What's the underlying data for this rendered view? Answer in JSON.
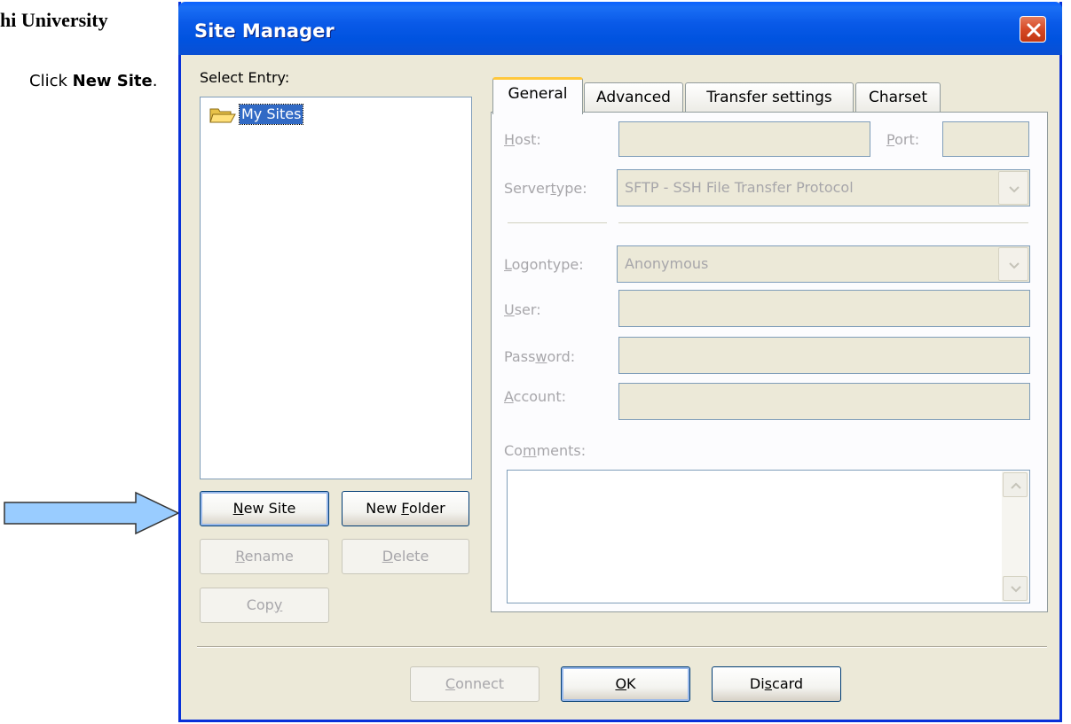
{
  "doc": {
    "title_fragment": "hi University",
    "instruction_prefix": "Click ",
    "instruction_bold": "New Site",
    "instruction_suffix": "."
  },
  "window": {
    "title": "Site Manager",
    "close_icon": "close-icon"
  },
  "left": {
    "select_entry_label": "Select Entry:",
    "tree": [
      {
        "label": "My Sites",
        "icon": "folder-open-icon",
        "selected": true
      }
    ],
    "buttons": {
      "new_site": {
        "mnemonic": "N",
        "rest": "ew Site"
      },
      "new_folder": {
        "pre": "New ",
        "mnemonic": "F",
        "rest": "older"
      },
      "rename": {
        "mnemonic": "R",
        "rest": "ename"
      },
      "delete": {
        "mnemonic": "D",
        "rest": "elete"
      },
      "copy": {
        "pre": "Cop",
        "mnemonic": "y",
        "rest": ""
      }
    }
  },
  "tabs": [
    {
      "label": "General",
      "active": true
    },
    {
      "label": "Advanced",
      "active": false
    },
    {
      "label": "Transfer settings",
      "active": false
    },
    {
      "label": "Charset",
      "active": false
    }
  ],
  "general": {
    "host": {
      "pre": "",
      "mnemonic": "H",
      "rest": "ost:",
      "value": ""
    },
    "port": {
      "pre": "",
      "mnemonic": "P",
      "rest": "ort:",
      "value": ""
    },
    "servertype": {
      "pre": "Server",
      "mnemonic": "t",
      "rest": "ype:",
      "value": "SFTP - SSH File Transfer Protocol"
    },
    "logontype": {
      "pre": "",
      "mnemonic": "L",
      "rest": "ogontype:",
      "value": "Anonymous"
    },
    "user": {
      "pre": "",
      "mnemonic": "U",
      "rest": "ser:",
      "value": ""
    },
    "password": {
      "pre": "Pass",
      "mnemonic": "w",
      "rest": "ord:",
      "value": ""
    },
    "account": {
      "pre": "",
      "mnemonic": "A",
      "rest": "ccount:",
      "value": ""
    },
    "comments": {
      "pre": "Co",
      "mnemonic": "m",
      "rest": "ments:",
      "value": ""
    }
  },
  "footer": {
    "connect": {
      "mnemonic": "C",
      "rest": "onnect"
    },
    "ok": {
      "mnemonic": "O",
      "rest": "K"
    },
    "discard": {
      "pre": "Di",
      "mnemonic": "s",
      "rest": "card"
    }
  },
  "colors": {
    "titlebar": "#0053e0",
    "selection": "#316ac5",
    "arrow_fill": "#99ccff"
  }
}
